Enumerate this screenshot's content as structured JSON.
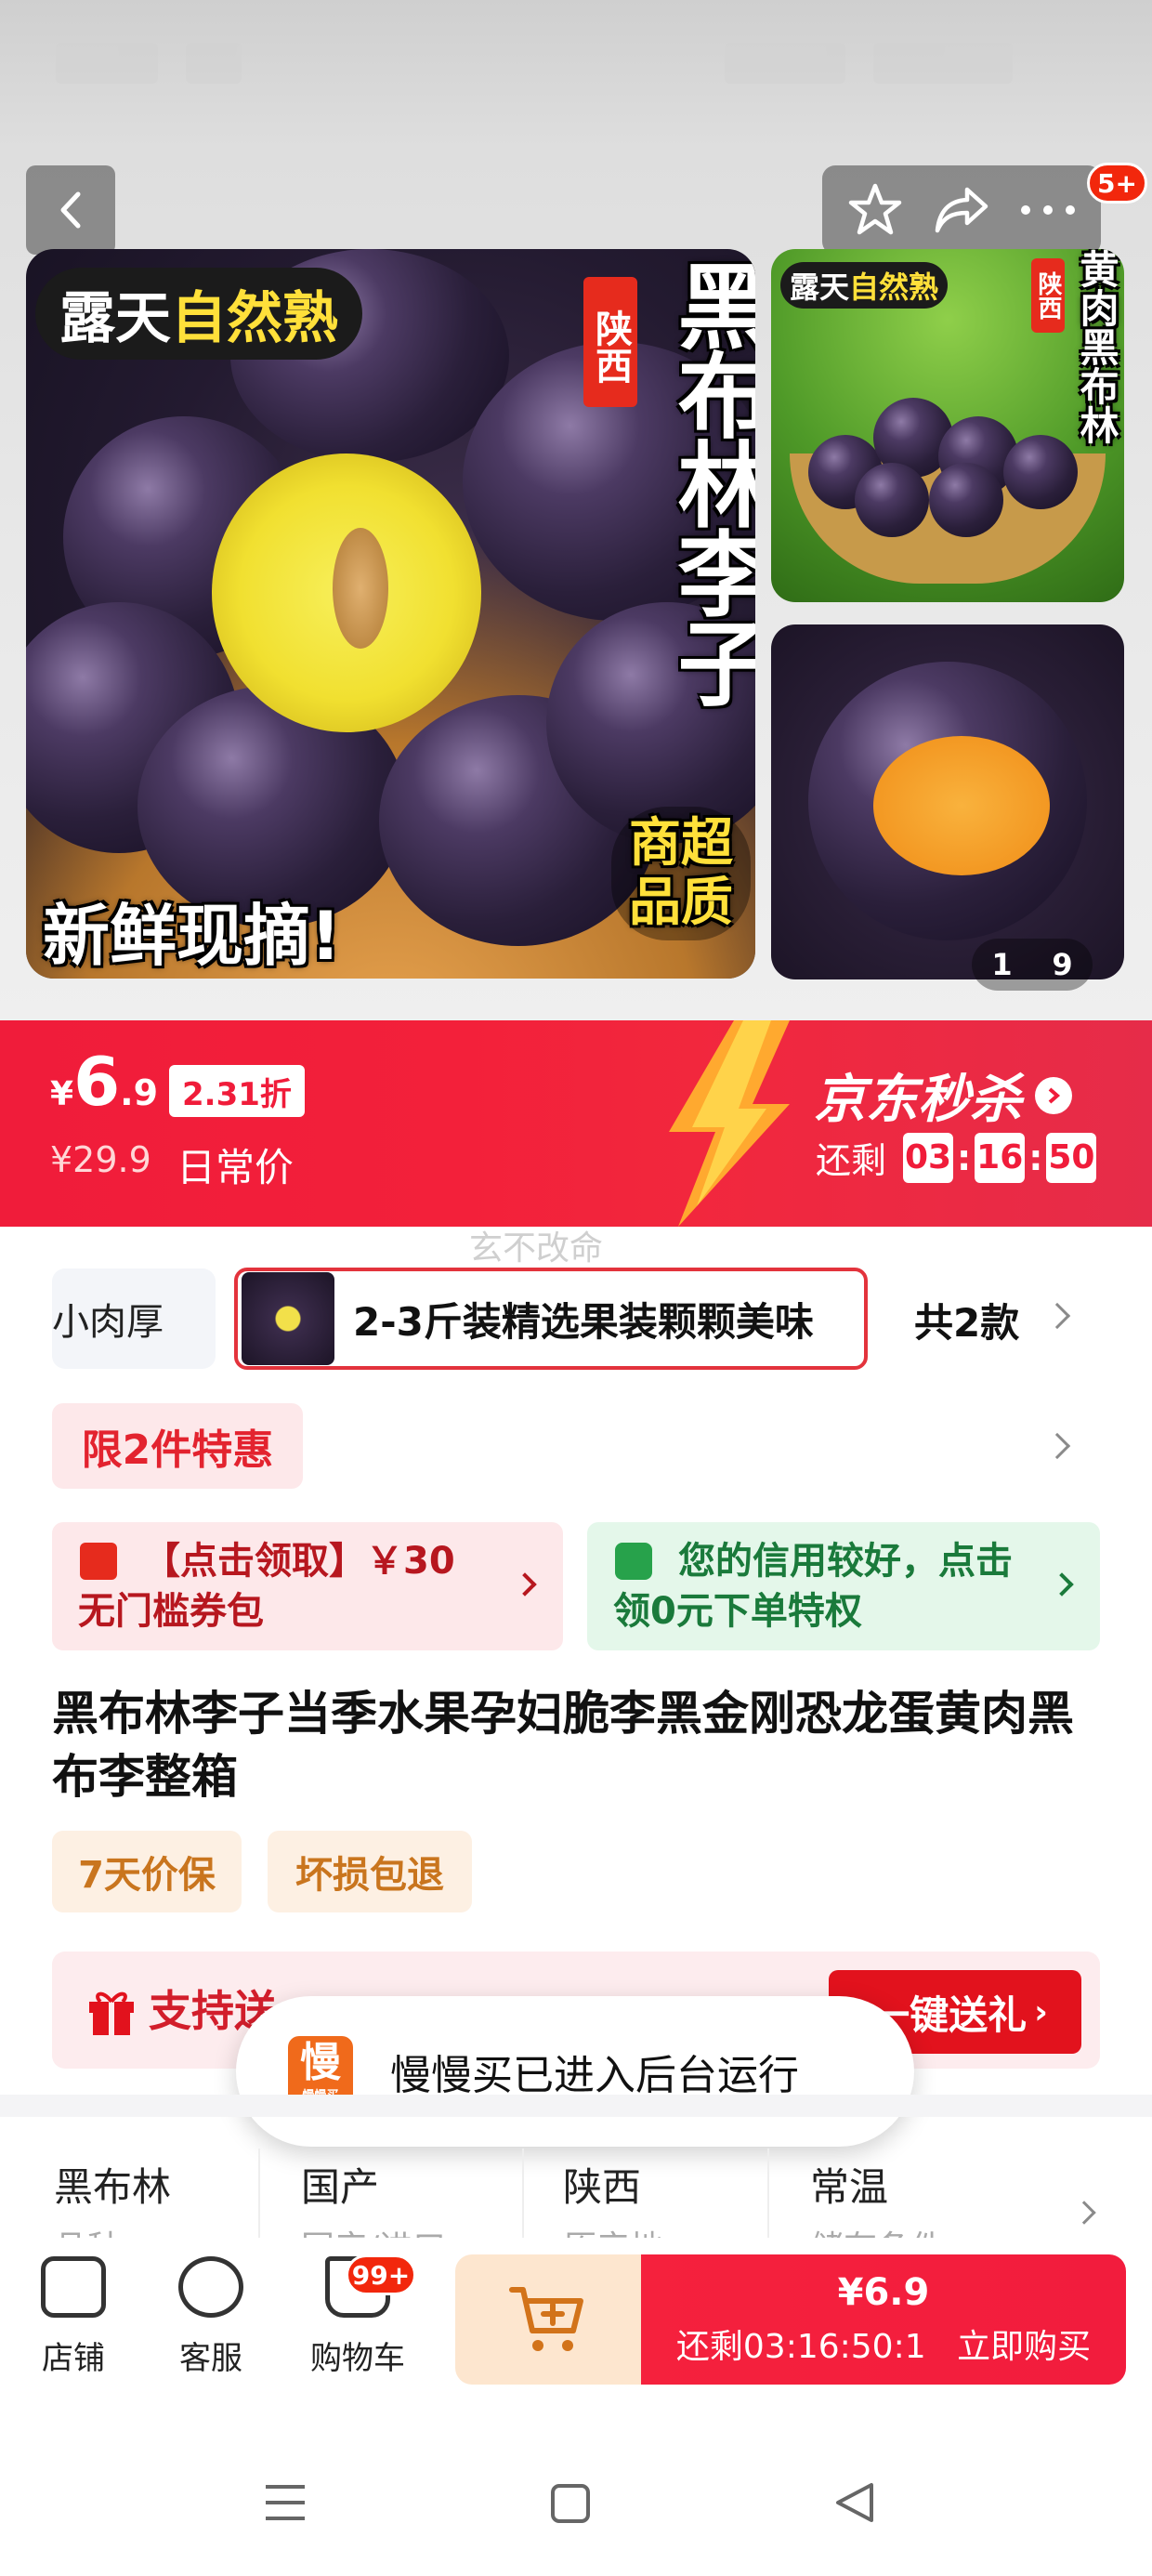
{
  "hero": {
    "image_counter": {
      "current": "1",
      "total": "9"
    },
    "main_image": {
      "tag_left": "露天",
      "tag_highlight": "自然熟",
      "origin": "陕西",
      "title_vertical": "黑布林李子",
      "quality": "商超品质",
      "fresh": "新鲜现摘!"
    },
    "side_image_1": {
      "tag_left": "露天",
      "tag_highlight": "自然熟",
      "origin": "陕西",
      "title_vertical": "黄肉黑布林"
    },
    "more_badge": "5+"
  },
  "price": {
    "currency": "¥",
    "integer": "6",
    "decimal": ".9",
    "discount": "2.31折",
    "original": "¥29.9",
    "original_label": "日常价"
  },
  "seckill": {
    "title": "京东秒杀",
    "remain_label": "还剩",
    "hours": "03",
    "minutes": "16",
    "seconds": "50"
  },
  "watermark": "玄不改命",
  "variants": {
    "partial_left": "汁小肉厚",
    "selected": "2-3斤装精选果装颗颗美味",
    "count": "共2款"
  },
  "promo": {
    "limit": "限2件特惠",
    "coupon_red": "【点击领取】￥30无门槛券包",
    "coupon_green": "您的信用较好，点击领0元下单特权"
  },
  "product_title": "黑布林李子当季水果孕妇脆李黑金刚恐龙蛋黄肉黑布李整箱",
  "services": [
    "7天价保",
    "坏损包退"
  ],
  "gift": {
    "label": "支持送",
    "button": "一键送礼"
  },
  "toast": {
    "app_name": "慢",
    "app_sub": "慢慢买",
    "message": "慢慢买已进入后台运行"
  },
  "attributes": [
    {
      "value": "黑布林",
      "label": "品种"
    },
    {
      "value": "国产",
      "label": "国产/进口"
    },
    {
      "value": "陕西",
      "label": "原产地"
    },
    {
      "value": "常温",
      "label": "储存条件"
    }
  ],
  "bottom": {
    "shop": "店铺",
    "service": "客服",
    "cart": "购物车",
    "cart_badge": "99+",
    "buy_price": "¥6.9",
    "buy_timer": "还剩03:16:50:1",
    "buy_label": "立即购买"
  },
  "colors": {
    "accent": "#f01c3a",
    "seckill_gold": "#ffc72c",
    "coupon_green": "#1a7a3b"
  }
}
